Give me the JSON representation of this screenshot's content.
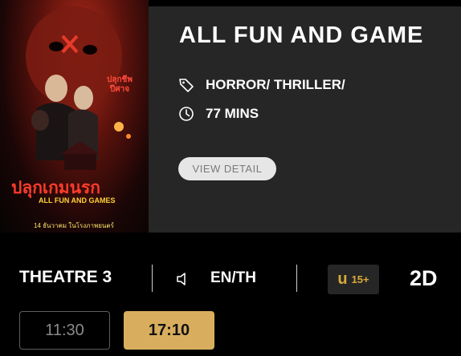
{
  "poster": {
    "thai_title": "ปลุกเกมนรก",
    "english_title": "ALL FUN AND GAMES",
    "tagline": "ปลุกชีพ ปีศาจ",
    "release": "14 ธันวาคม ในโรงภาพยนตร์"
  },
  "movie": {
    "title": "ALL FUN AND GAME",
    "genre": "HORROR/ THRILLER/",
    "duration": "77 MINS",
    "detail_button": "VIEW DETAIL"
  },
  "showing": {
    "theatre": "THEATRE 3",
    "language": "EN/TH",
    "rating_letter": "u",
    "rating_age": "15+",
    "format": "2D",
    "times": [
      "11:30",
      "17:10"
    ]
  },
  "colors": {
    "panel": "#262626",
    "accent_gold": "#d8ae5e",
    "rating_gold": "#d8a93a"
  }
}
